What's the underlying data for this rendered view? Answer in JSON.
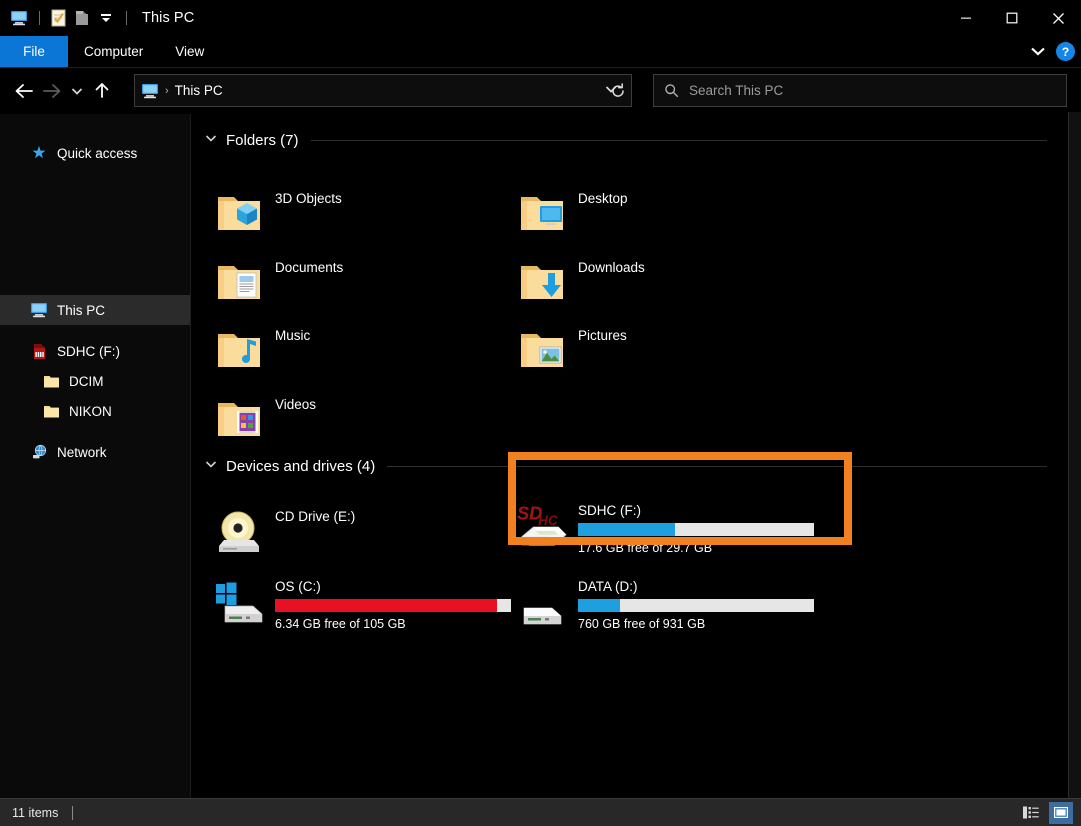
{
  "window": {
    "title": "This PC",
    "quick_access_icons": [
      "this-pc-icon",
      "properties-icon",
      "new-folder-icon",
      "customize-chevron-icon"
    ],
    "controls": {
      "minimize": "minimize-icon",
      "maximize": "maximize-icon",
      "close": "close-icon"
    }
  },
  "ribbon": {
    "tabs": [
      {
        "label": "File",
        "active": true
      },
      {
        "label": "Computer",
        "active": false
      },
      {
        "label": "View",
        "active": false
      }
    ],
    "expand_icon": "chevron-down-icon",
    "help_label": "?"
  },
  "toolbar": {
    "back_icon": "arrow-left-icon",
    "forward_icon": "arrow-right-icon",
    "recent_icon": "chevron-down-icon",
    "up_icon": "arrow-up-icon",
    "refresh_icon": "refresh-icon",
    "address_dropdown_icon": "chevron-down-icon"
  },
  "address": {
    "icon": "this-pc-icon",
    "separator": "›",
    "path": "This PC"
  },
  "search": {
    "icon": "search-icon",
    "placeholder": "Search This PC"
  },
  "sidebar": {
    "items": [
      {
        "label": "Quick access",
        "icon": "star-icon",
        "selected": false,
        "indent": false
      },
      {
        "label": "This PC",
        "icon": "this-pc-icon",
        "selected": true,
        "indent": false
      },
      {
        "label": "SDHC (F:)",
        "icon": "sd-card-icon",
        "selected": false,
        "indent": false
      },
      {
        "label": "DCIM",
        "icon": "folder-icon",
        "selected": false,
        "indent": true
      },
      {
        "label": "NIKON",
        "icon": "folder-icon",
        "selected": false,
        "indent": true
      },
      {
        "label": "Network",
        "icon": "network-icon",
        "selected": false,
        "indent": false
      }
    ]
  },
  "main": {
    "folders_group": {
      "title": "Folders (7)",
      "chevron": "chevron-down-icon",
      "items": [
        {
          "label": "3D Objects",
          "icon": "folder-3d-objects-icon"
        },
        {
          "label": "Desktop",
          "icon": "folder-desktop-icon"
        },
        {
          "label": "Documents",
          "icon": "folder-documents-icon"
        },
        {
          "label": "Downloads",
          "icon": "folder-downloads-icon"
        },
        {
          "label": "Music",
          "icon": "folder-music-icon"
        },
        {
          "label": "Pictures",
          "icon": "folder-pictures-icon"
        },
        {
          "label": "Videos",
          "icon": "folder-videos-icon"
        }
      ]
    },
    "drives_group": {
      "title": "Devices and drives (4)",
      "chevron": "chevron-down-icon",
      "items": [
        {
          "name": "CD Drive (E:)",
          "icon": "cd-drive-icon",
          "has_bar": false,
          "free_text": ""
        },
        {
          "name": "SDHC (F:)",
          "icon": "sd-card-drive-icon",
          "has_bar": true,
          "bar_color": "#1e9fe0",
          "bar_percent": 41,
          "free_text": "17.6 GB free of 29.7 GB",
          "highlighted": true
        },
        {
          "name": "OS (C:)",
          "icon": "windows-drive-icon",
          "has_bar": true,
          "bar_color": "#e81123",
          "bar_percent": 94,
          "free_text": "6.34 GB free of 105 GB"
        },
        {
          "name": "DATA (D:)",
          "icon": "hard-drive-icon",
          "has_bar": true,
          "bar_color": "#1e9fe0",
          "bar_percent": 18,
          "free_text": "760 GB free of 931 GB"
        }
      ]
    }
  },
  "highlight": {
    "color": "#F08020",
    "border_width": 8
  },
  "statusbar": {
    "item_count": "11 items",
    "view_buttons": [
      {
        "icon": "details-view-icon",
        "active": false
      },
      {
        "icon": "large-icons-view-icon",
        "active": true
      }
    ]
  }
}
